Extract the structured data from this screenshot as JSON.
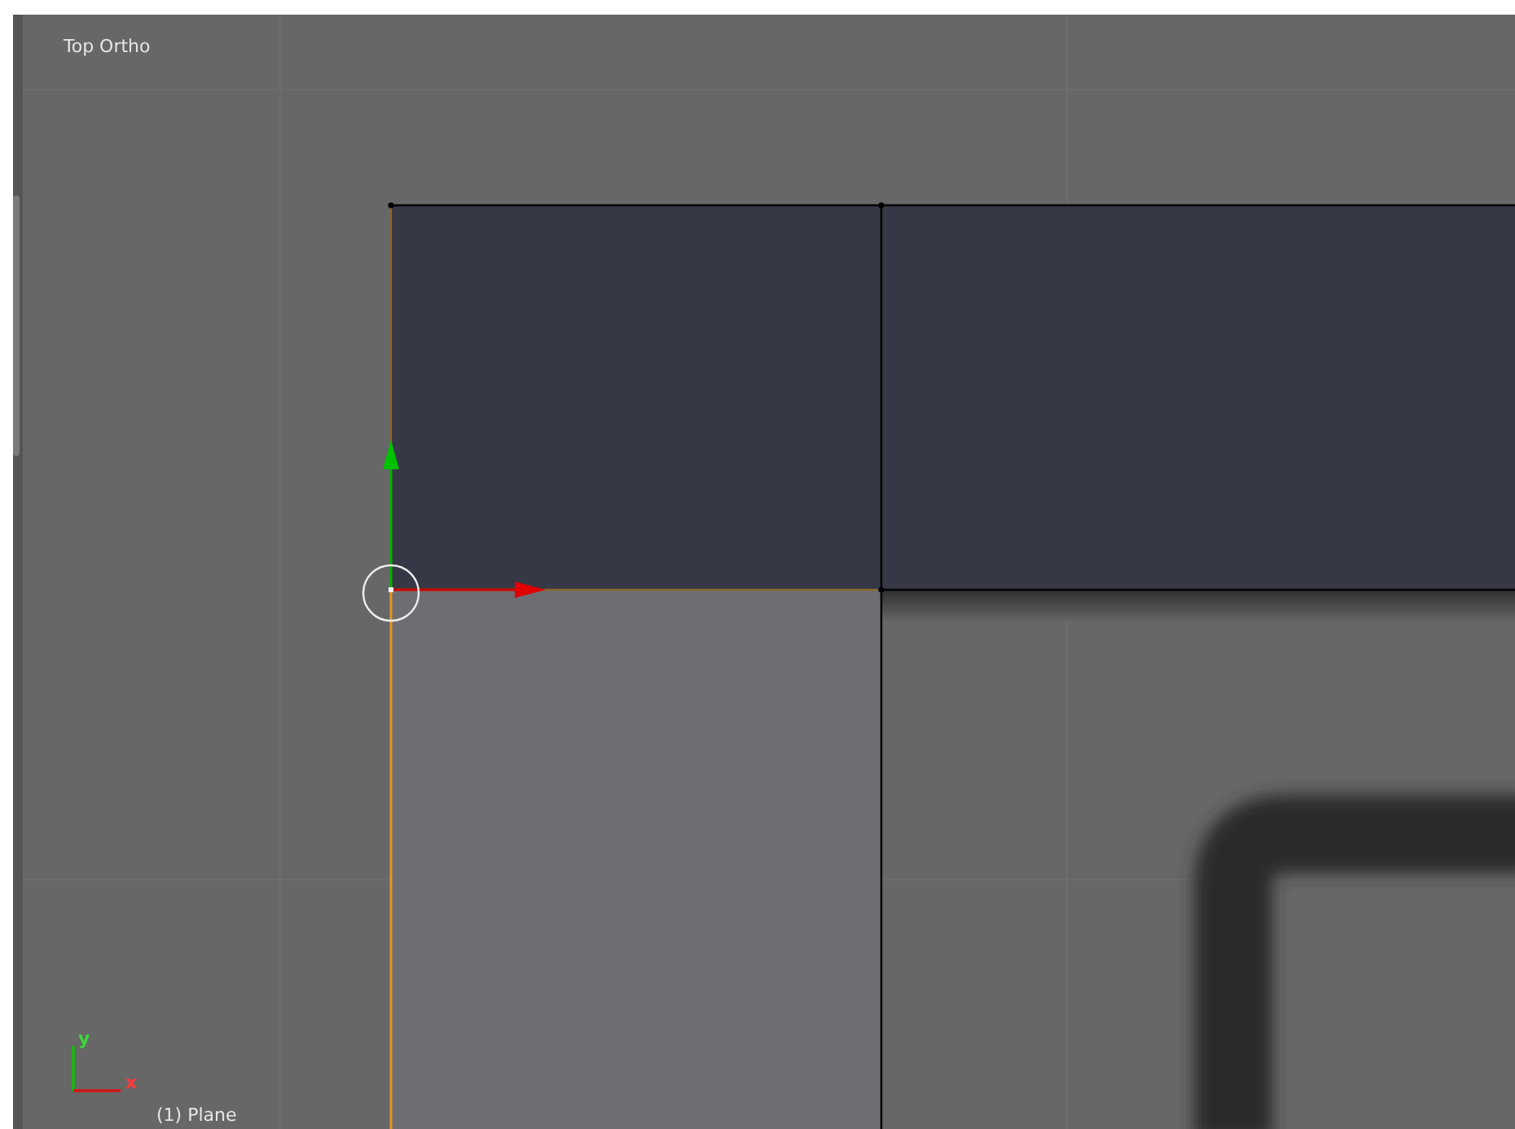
{
  "viewport": {
    "view_name": "Top Ortho",
    "object_label": "(1) Plane"
  },
  "axis_indicator": {
    "y_label": "y",
    "x_label": "x"
  }
}
